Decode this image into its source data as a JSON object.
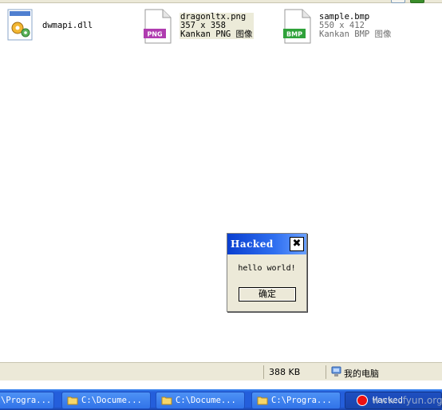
{
  "files": [
    {
      "name": "dwmapi.dll",
      "icon": "dll-gear-icon"
    },
    {
      "name": "dragonltx.png",
      "dimensions": "357 x 358",
      "type": "Kankan PNG 图像",
      "badge": "PNG",
      "icon": "png-file-icon",
      "badge_color": "#b03cb0"
    },
    {
      "name": "sample.bmp",
      "dimensions": "550 x 412",
      "type": "Kankan BMP 图像",
      "badge": "BMP",
      "icon": "bmp-file-icon",
      "badge_color": "#2fa23a"
    }
  ],
  "dialog": {
    "title": "Hacked",
    "close_label": "✖",
    "message": "hello world!",
    "ok_label": "确定"
  },
  "statusbar": {
    "size": "388 KB",
    "location": "我的电脑"
  },
  "taskbar": {
    "items": [
      {
        "label": "\\Progra...",
        "icon": ""
      },
      {
        "label": "C:\\Docume...",
        "icon": "folder-icon"
      },
      {
        "label": "C:\\Docume...",
        "icon": "folder-icon"
      },
      {
        "label": "C:\\Progra...",
        "icon": "folder-icon"
      },
      {
        "label": "Hacked",
        "icon": "app-icon",
        "active": true
      }
    ]
  },
  "watermark": "www.cfyun.org",
  "colors": {
    "titlebar": "#0a3fd0",
    "taskbar": "#245edb",
    "statusbar": "#ece9d8"
  }
}
